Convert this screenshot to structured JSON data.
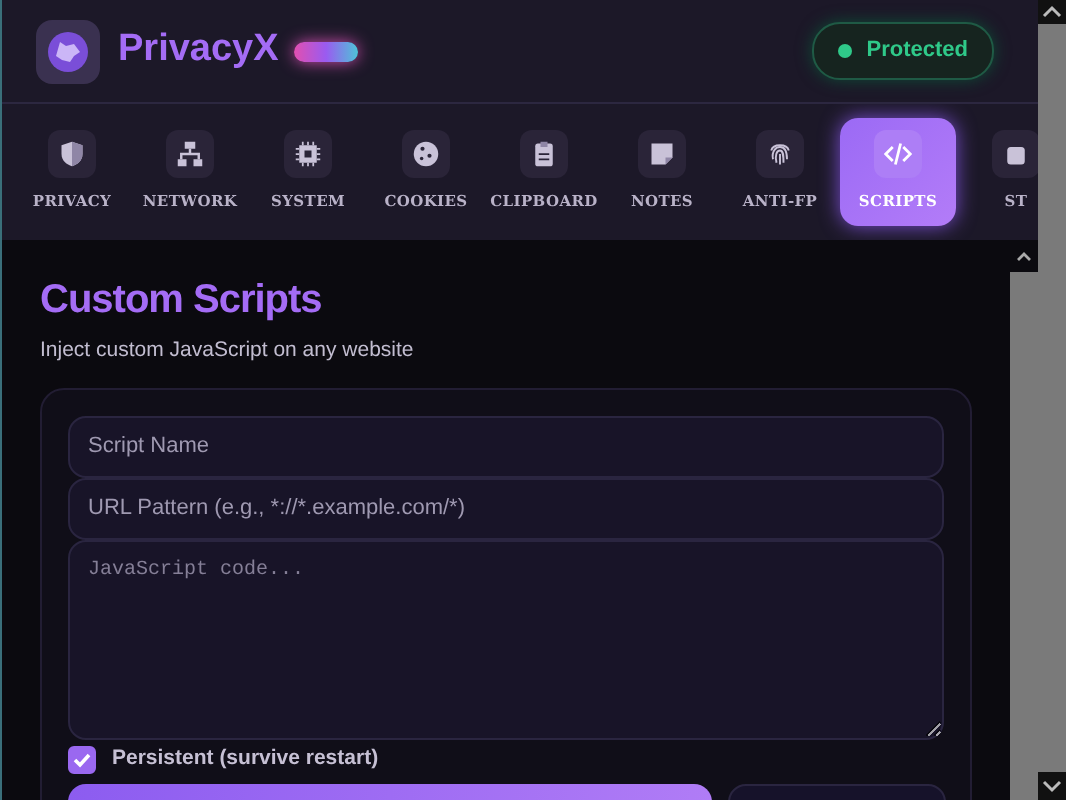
{
  "app": {
    "title": "PrivacyX",
    "status": "Protected"
  },
  "tabs": [
    {
      "label": "PRIVACY",
      "selected": false
    },
    {
      "label": "NETWORK",
      "selected": false
    },
    {
      "label": "SYSTEM",
      "selected": false
    },
    {
      "label": "COOKIES",
      "selected": false
    },
    {
      "label": "CLIPBOARD",
      "selected": false
    },
    {
      "label": "NOTES",
      "selected": false
    },
    {
      "label": "ANTI-FP",
      "selected": false
    },
    {
      "label": "SCRIPTS",
      "selected": true
    },
    {
      "label": "ST",
      "selected": false
    }
  ],
  "section": {
    "title": "Custom Scripts",
    "subtitle": "Inject custom JavaScript on any website"
  },
  "form": {
    "name_placeholder": "Script Name",
    "url_placeholder": "URL Pattern (e.g., *://*.example.com/*)",
    "code_placeholder": "JavaScript code...",
    "persistent": {
      "label": "Persistent (survive restart)",
      "checked": true
    }
  }
}
